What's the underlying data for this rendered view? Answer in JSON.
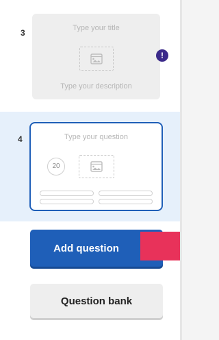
{
  "slides": [
    {
      "number": "3",
      "title_placeholder": "Type your title",
      "description_placeholder": "Type your description",
      "warning_badge": "!"
    },
    {
      "number": "4",
      "question_placeholder": "Type your question",
      "timer": "20"
    }
  ],
  "buttons": {
    "add_question": "Add question",
    "question_bank": "Question bank"
  },
  "colors": {
    "accent_blue": "#1f5fb8",
    "selected_background": "#e6f0fb",
    "warning_purple": "#3b2a8a",
    "pink_tab": "#e8325a"
  },
  "icons": {
    "image_placeholder": "image-icon",
    "warning": "exclamation-icon"
  }
}
